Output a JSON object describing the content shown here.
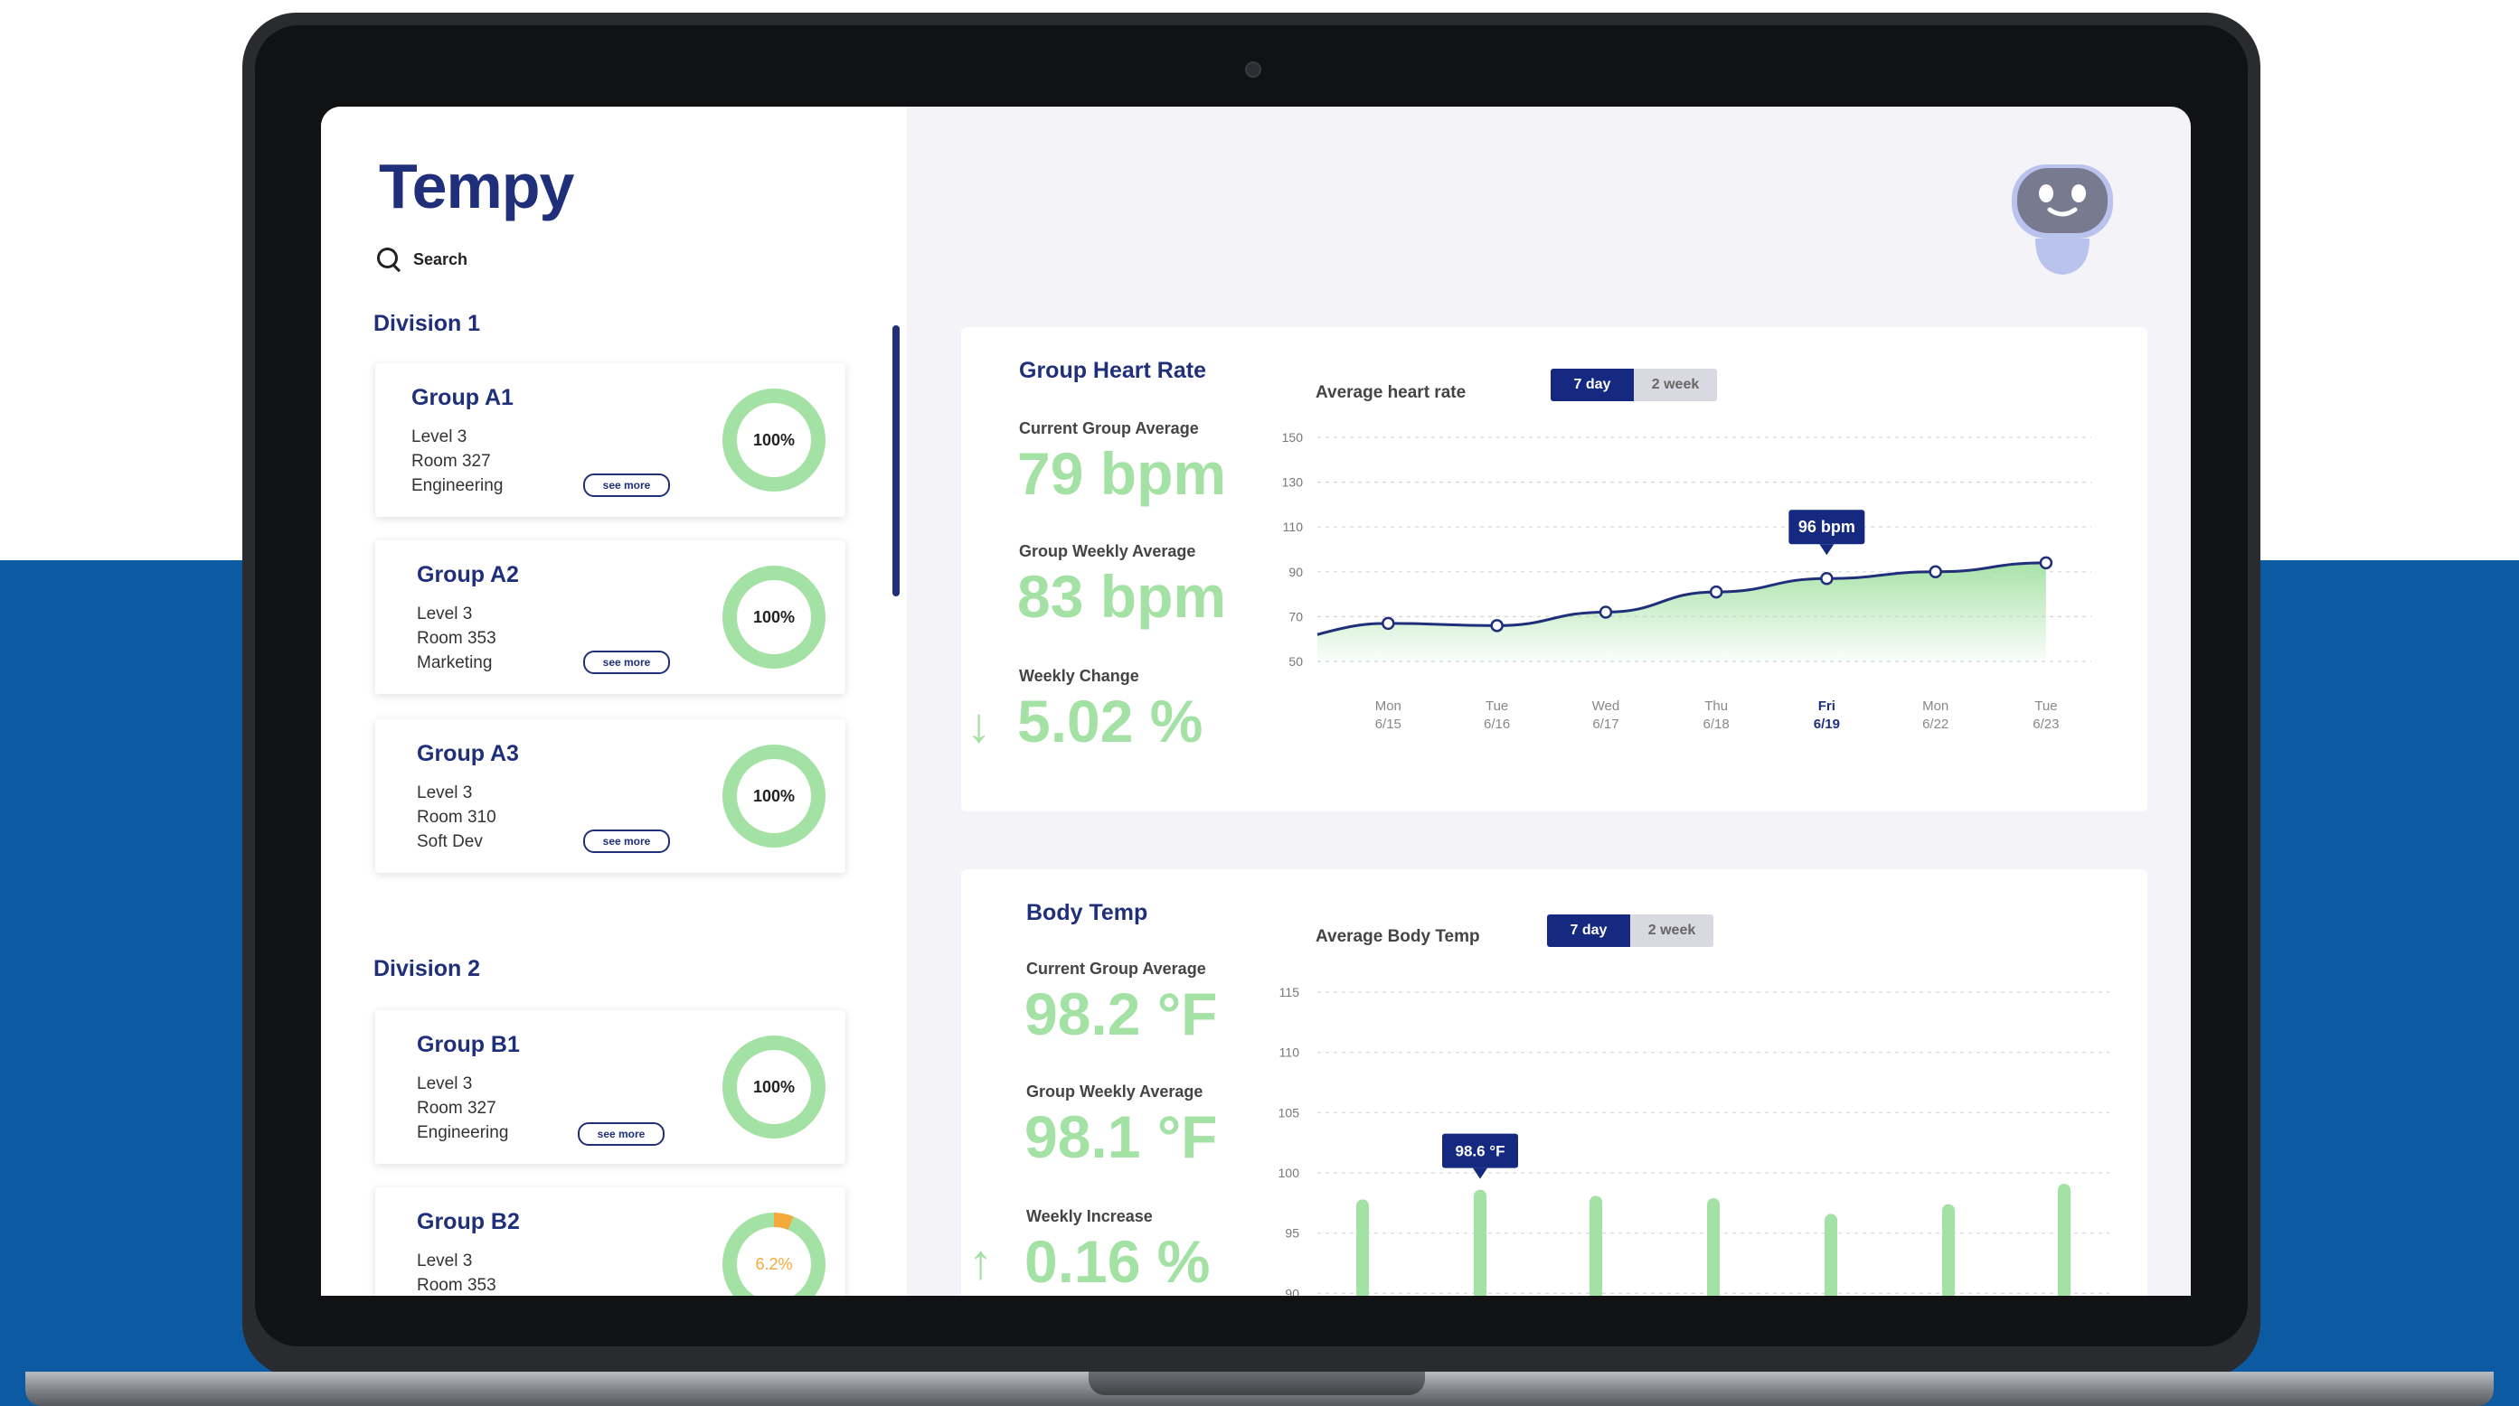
{
  "app": {
    "name": "Tempy",
    "search_label": "Search"
  },
  "sidebar": {
    "divisions": [
      {
        "title": "Division 1"
      },
      {
        "title": "Division 2"
      }
    ],
    "groups": [
      {
        "name": "Group A1",
        "level": "Level 3",
        "room": "Room 327",
        "dept": "Engineering",
        "percent": "100%",
        "see_more": "see more"
      },
      {
        "name": "Group A2",
        "level": "Level 3",
        "room": "Room 353",
        "dept": "Marketing",
        "percent": "100%",
        "see_more": "see more"
      },
      {
        "name": "Group A3",
        "level": "Level 3",
        "room": "Room 310",
        "dept": "Soft Dev",
        "percent": "100%",
        "see_more": "see more"
      },
      {
        "name": "Group B1",
        "level": "Level 3",
        "room": "Room 327",
        "dept": "Engineering",
        "percent": "100%",
        "see_more": "see more"
      },
      {
        "name": "Group B2",
        "level": "Level 3",
        "room": "Room 353",
        "dept": "",
        "percent": "6.2%",
        "see_more": ""
      }
    ]
  },
  "heart": {
    "title": "Group Heart Rate",
    "current_label": "Current Group Average",
    "current_value": "79 bpm",
    "weekly_label": "Group Weekly Average",
    "weekly_value": "83 bpm",
    "change_label": "Weekly Change",
    "change_arrow": "↓",
    "change_value": "5.02 %",
    "chart_title": "Average heart rate",
    "toggle_active": "7 day",
    "toggle_inactive": "2 week",
    "tooltip": "96 bpm"
  },
  "temp": {
    "title": "Body Temp",
    "current_label": "Current Group Average",
    "current_value": "98.2 °F",
    "weekly_label": "Group Weekly Average",
    "weekly_value": "98.1 °F",
    "change_label": "Weekly Increase",
    "change_arrow": "↑",
    "change_value": "0.16 %",
    "chart_title": "Average Body Temp",
    "toggle_active": "7 day",
    "toggle_inactive": "2 week",
    "tooltip": "98.6 °F"
  },
  "colors": {
    "brand": "#1f2f7a",
    "accent_green": "#a4e1a4",
    "warning_orange": "#f4a93b",
    "background_blue": "#0c5aa2"
  },
  "chart_data": [
    {
      "type": "area",
      "ylim": [
        50,
        150
      ],
      "yticks": [
        150,
        130,
        110,
        90,
        70,
        50
      ],
      "categories": [
        "Mon 6/15",
        "Tue 6/16",
        "Wed 6/17",
        "Thu 6/18",
        "Fri 6/19",
        "Mon 6/22",
        "Tue 6/23"
      ],
      "x_day": [
        "Mon",
        "Tue",
        "Wed",
        "Thu",
        "Fri",
        "Mon",
        "Tue"
      ],
      "x_date": [
        "6/15",
        "6/16",
        "6/17",
        "6/18",
        "6/19",
        "6/22",
        "6/23"
      ],
      "series": [
        {
          "values": [
            67,
            66,
            72,
            81,
            87,
            90,
            94
          ]
        }
      ],
      "highlight_index": 4,
      "grid": true
    },
    {
      "type": "bar",
      "ylim": [
        88,
        115
      ],
      "yticks": [
        115,
        110,
        105,
        100,
        95,
        90
      ],
      "categories": [
        "",
        "",
        "",
        "",
        "",
        "",
        ""
      ],
      "series": [
        {
          "values": [
            97.8,
            98.6,
            98.1,
            97.9,
            96.6,
            97.4,
            99.1
          ]
        }
      ],
      "highlight_index": 1,
      "grid": true
    }
  ]
}
